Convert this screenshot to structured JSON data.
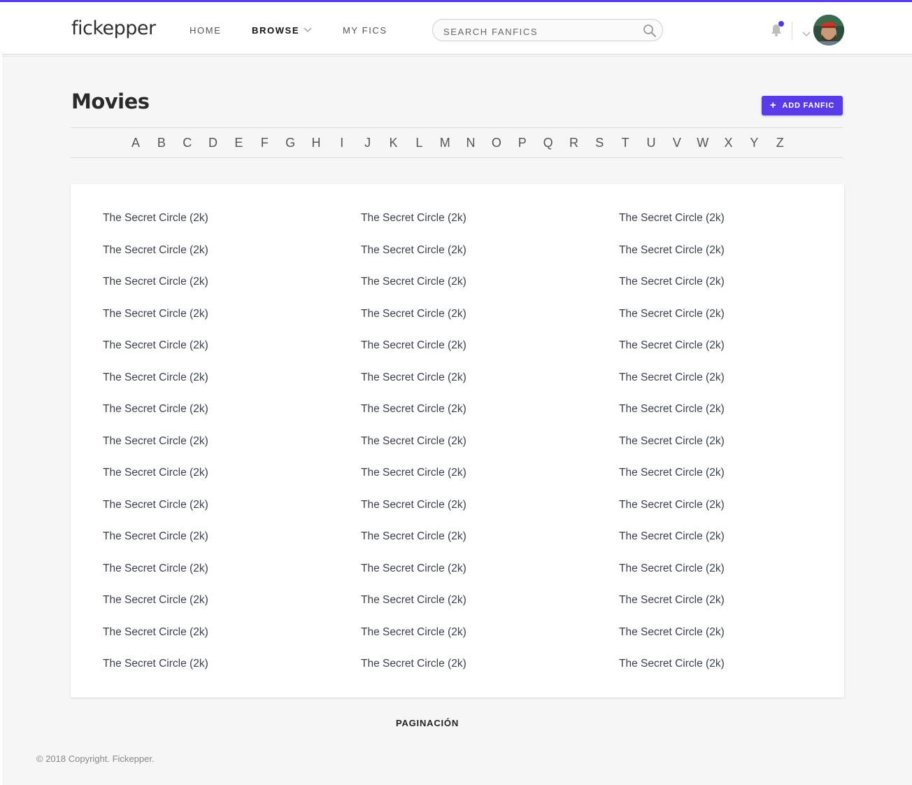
{
  "header": {
    "logo": "fickepper",
    "nav": {
      "home": "HOME",
      "browse": "BROWSE",
      "my_fics": "MY FICS"
    },
    "search": {
      "placeholder": "SEARCH FANFICS"
    },
    "accent_color": "#5a3bea"
  },
  "page": {
    "title": "Movies",
    "add_button": "ADD FANFIC",
    "alphabet": [
      "A",
      "B",
      "C",
      "D",
      "E",
      "F",
      "G",
      "H",
      "I",
      "J",
      "K",
      "L",
      "M",
      "N",
      "O",
      "P",
      "Q",
      "R",
      "S",
      "T",
      "U",
      "V",
      "W",
      "X",
      "Y",
      "Z"
    ],
    "columns": [
      [
        "The Secret Circle (2k)",
        "The Secret Circle (2k)",
        "The Secret Circle (2k)",
        "The Secret Circle (2k)",
        "The Secret Circle (2k)",
        "The Secret Circle (2k)",
        "The Secret Circle (2k)",
        "The Secret Circle (2k)",
        "The Secret Circle (2k)",
        "The Secret Circle (2k)",
        "The Secret Circle (2k)",
        "The Secret Circle (2k)",
        "The Secret Circle (2k)",
        "The Secret Circle (2k)",
        "The Secret Circle (2k)"
      ],
      [
        "The Secret Circle (2k)",
        "The Secret Circle (2k)",
        "The Secret Circle (2k)",
        "The Secret Circle (2k)",
        "The Secret Circle (2k)",
        "The Secret Circle (2k)",
        "The Secret Circle (2k)",
        "The Secret Circle (2k)",
        "The Secret Circle (2k)",
        "The Secret Circle (2k)",
        "The Secret Circle (2k)",
        "The Secret Circle (2k)",
        "The Secret Circle (2k)",
        "The Secret Circle (2k)",
        "The Secret Circle (2k)"
      ],
      [
        "The Secret Circle (2k)",
        "The Secret Circle (2k)",
        "The Secret Circle (2k)",
        "The Secret Circle (2k)",
        "The Secret Circle (2k)",
        "The Secret Circle (2k)",
        "The Secret Circle (2k)",
        "The Secret Circle (2k)",
        "The Secret Circle (2k)",
        "The Secret Circle (2k)",
        "The Secret Circle (2k)",
        "The Secret Circle (2k)",
        "The Secret Circle (2k)",
        "The Secret Circle (2k)",
        "The Secret Circle (2k)"
      ]
    ],
    "pagination": "PAGINACIÓN"
  },
  "footer": {
    "copyright": "© 2018 Copyright. Fickepper."
  }
}
